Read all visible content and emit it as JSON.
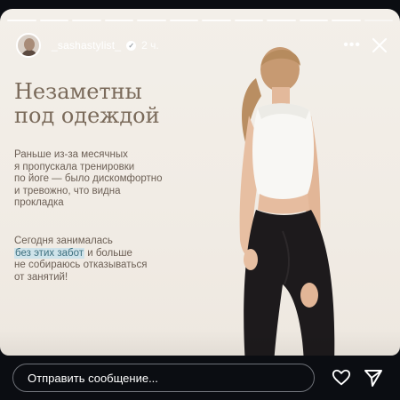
{
  "story": {
    "progress_total": 12,
    "progress_done": 11
  },
  "header": {
    "username": "_sashastylist_",
    "time": "2 ч.",
    "more_label": "•••"
  },
  "content": {
    "headline_line1": "Незаметны",
    "headline_line2": "под одеждой",
    "para1_lines": [
      "Раньше из-за месячных",
      "я пропускала тренировки",
      "по йоге — было дискомфортно",
      "и тревожно, что видна",
      "прокладка"
    ],
    "para2_line1": "Сегодня занималась",
    "para2_highlight": "без этих забот",
    "para2_after_highlight": " и больше",
    "para2_line3": "не собираюсь отказываться",
    "para2_line4": "от занятий!"
  },
  "reply": {
    "placeholder": "Отправить сообщение..."
  },
  "icons": {
    "verified": "verified-badge-icon",
    "more": "more-icon",
    "close": "close-icon",
    "like": "heart-icon",
    "send": "send-icon"
  },
  "colors": {
    "headline": "#7a6a5a",
    "body_text": "#6c5f55",
    "highlight_bg": "#cfe3ea",
    "highlight_text": "#3d6f7e",
    "background": "#0b0d12"
  }
}
